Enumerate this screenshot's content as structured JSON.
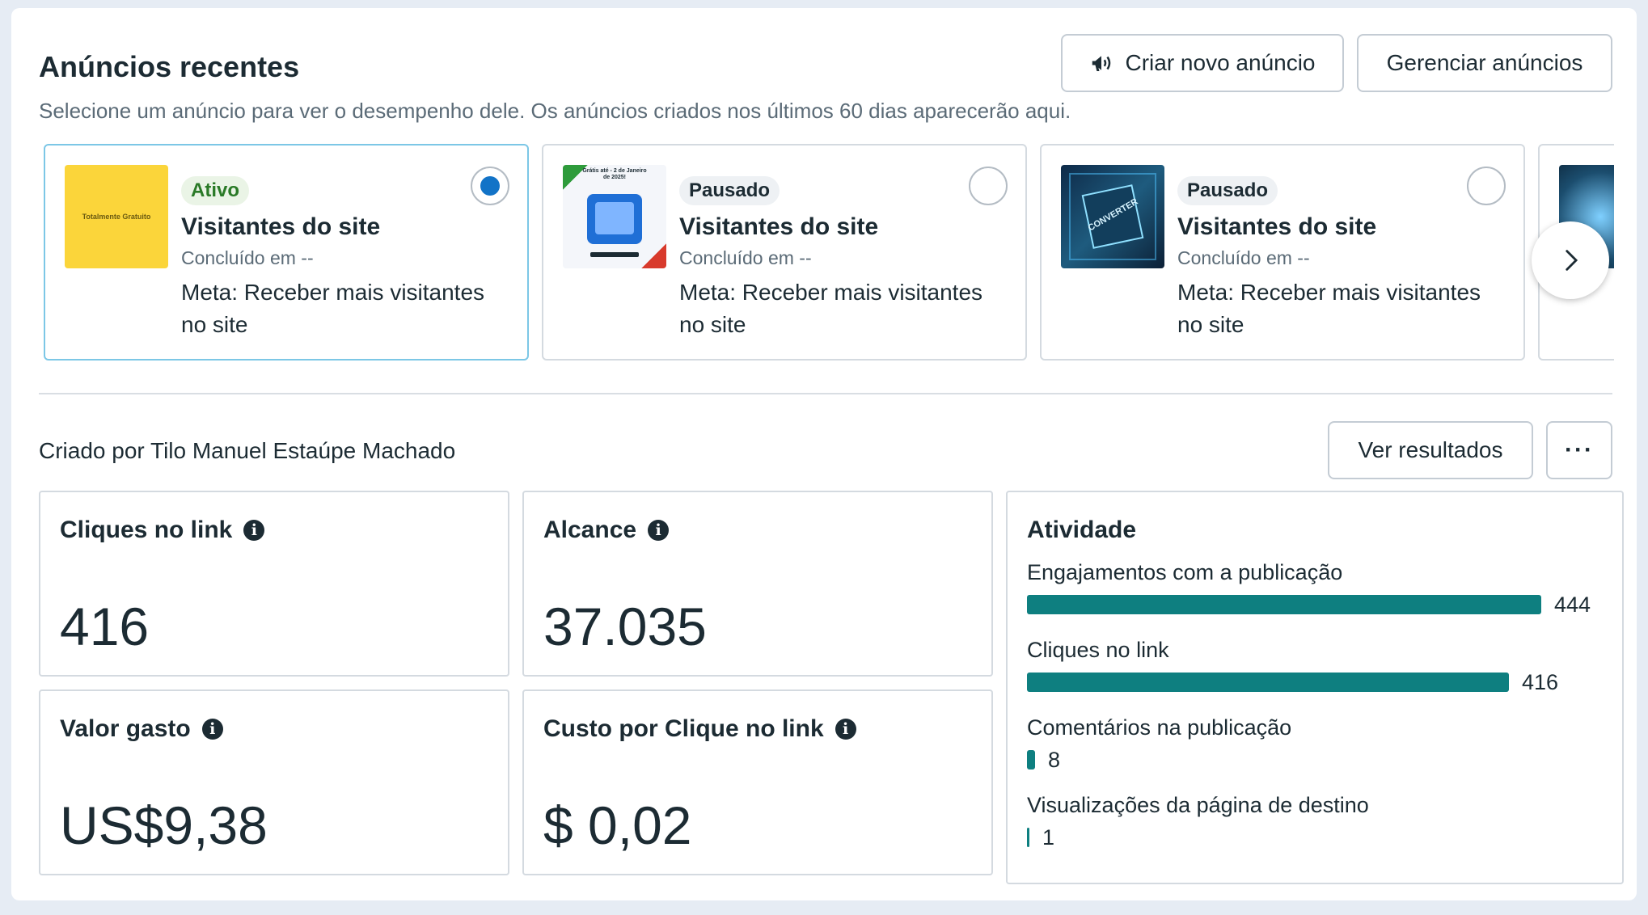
{
  "header": {
    "title": "Anúncios recentes",
    "subtitle": "Selecione um anúncio para ver o desempenho dele. Os anúncios criados nos últimos 60 dias aparecerão aqui.",
    "create_label": "Criar novo anúncio",
    "manage_label": "Gerenciar anúncios"
  },
  "cards": [
    {
      "status": "Ativo",
      "name": "Visitantes do site",
      "ended": "Concluído em --",
      "goal": "Meta: Receber mais visitantes no site",
      "selected": true,
      "thumb_text": "Totalmente Gratuito"
    },
    {
      "status": "Pausado",
      "name": "Visitantes do site",
      "ended": "Concluído em --",
      "goal": "Meta: Receber mais visitantes no site",
      "selected": false,
      "thumb_text": "Grátis até - 2 de Janeiro de 2025!"
    },
    {
      "status": "Pausado",
      "name": "Visitantes do site",
      "ended": "Concluído em --",
      "goal": "Meta: Receber mais visitantes no site",
      "selected": false,
      "thumb_text": "CONVERTER"
    }
  ],
  "creator_text": "Criado por Tilo Manuel Estaúpe Machado",
  "view_results_label": "Ver resultados",
  "more_label": "···",
  "metrics": {
    "link_clicks": {
      "title": "Cliques no link",
      "value": "416"
    },
    "reach": {
      "title": "Alcance",
      "value": "37.035"
    },
    "amount_spent": {
      "title": "Valor gasto",
      "value": "US$9,38"
    },
    "cost_per_click": {
      "title": "Custo por Clique no link",
      "value": "$ 0,02"
    }
  },
  "activity": {
    "title": "Atividade",
    "items": [
      {
        "label": "Engajamentos com a publicação",
        "value": "444",
        "fraction": 1.0
      },
      {
        "label": "Cliques no link",
        "value": "416",
        "fraction": 0.937
      },
      {
        "label": "Comentários na publicação",
        "value": "8",
        "fraction": 0.018
      },
      {
        "label": "Visualizações da página de destino",
        "value": "1",
        "fraction": 0.002
      }
    ]
  },
  "colors": {
    "accent": "#1273c7",
    "bar": "#0e7f80",
    "active_badge": "#2a7a27"
  },
  "icons": {
    "create": "megaphone-icon",
    "next": "chevron-right-icon",
    "info": "info-icon"
  }
}
